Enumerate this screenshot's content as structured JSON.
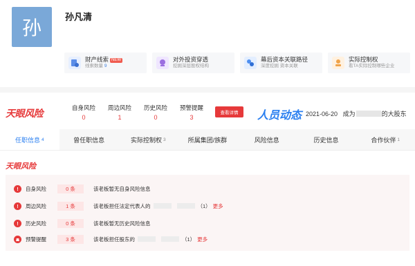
{
  "person": {
    "avatar_char": "孙",
    "name": "孙凡清"
  },
  "cards": [
    {
      "title": "财产线索",
      "badge": "NEW",
      "sub_prefix": "线索数量 ",
      "sub_num": "9",
      "icon": "property-icon",
      "color": "#5b8de8"
    },
    {
      "title": "对外投资穿透",
      "badge": "",
      "sub_prefix": "挖掘深层股权结构",
      "sub_num": "",
      "icon": "investment-icon",
      "color": "#9b6fe0"
    },
    {
      "title": "幕后资本关联路径",
      "badge": "",
      "sub_prefix": "深度挖掘 资本关联",
      "sub_num": "",
      "icon": "capital-path-icon",
      "color": "#4e8ff0"
    },
    {
      "title": "实际控制权",
      "badge": "",
      "sub_prefix": "看TA实际控制哪些企业",
      "sub_num": "",
      "icon": "control-icon",
      "color": "#f0a34a"
    }
  ],
  "risk_strip": {
    "logo": "天眼风险",
    "columns": [
      {
        "label": "自身风险",
        "value": "0"
      },
      {
        "label": "周边风险",
        "value": "1"
      },
      {
        "label": "历史风险",
        "value": "0"
      },
      {
        "label": "预警提醒",
        "value": "3"
      }
    ],
    "detail_button": "查看详情",
    "dynamic_logo": "人员动态",
    "dynamic_date": "2021-06-20",
    "dynamic_pre": "成为",
    "dynamic_post": "的大股东"
  },
  "tabs": [
    {
      "label": "任职信息",
      "count": "4",
      "active": true
    },
    {
      "label": "曾任职信息",
      "count": "",
      "active": false
    },
    {
      "label": "实际控制权",
      "count": "3",
      "active": false
    },
    {
      "label": "所属集团/族群",
      "count": "",
      "active": false
    },
    {
      "label": "风险信息",
      "count": "",
      "active": false
    },
    {
      "label": "历史信息",
      "count": "",
      "active": false
    },
    {
      "label": "合作伙伴",
      "count": "1",
      "active": false
    }
  ],
  "panel": {
    "title": "天眼风险",
    "rows": [
      {
        "label": "自身风险",
        "count": "0 条",
        "desc": "该老板暂无自身风险信息",
        "extra": "",
        "more": ""
      },
      {
        "label": "周边风险",
        "count": "1 条",
        "desc": "该老板担任法定代表人的",
        "extra": "（1）",
        "more": "更多"
      },
      {
        "label": "历史风险",
        "count": "0 条",
        "desc": "该老板暂无历史风险信息",
        "extra": "",
        "more": ""
      },
      {
        "label": "预警提醒",
        "count": "3 条",
        "desc": "该老板担任股东的",
        "extra": "（1）",
        "more": "更多"
      }
    ]
  },
  "colors": {
    "brand_red": "#e6393a",
    "brand_blue": "#2a7ff0",
    "avatar_bg": "#7aa8d8"
  }
}
